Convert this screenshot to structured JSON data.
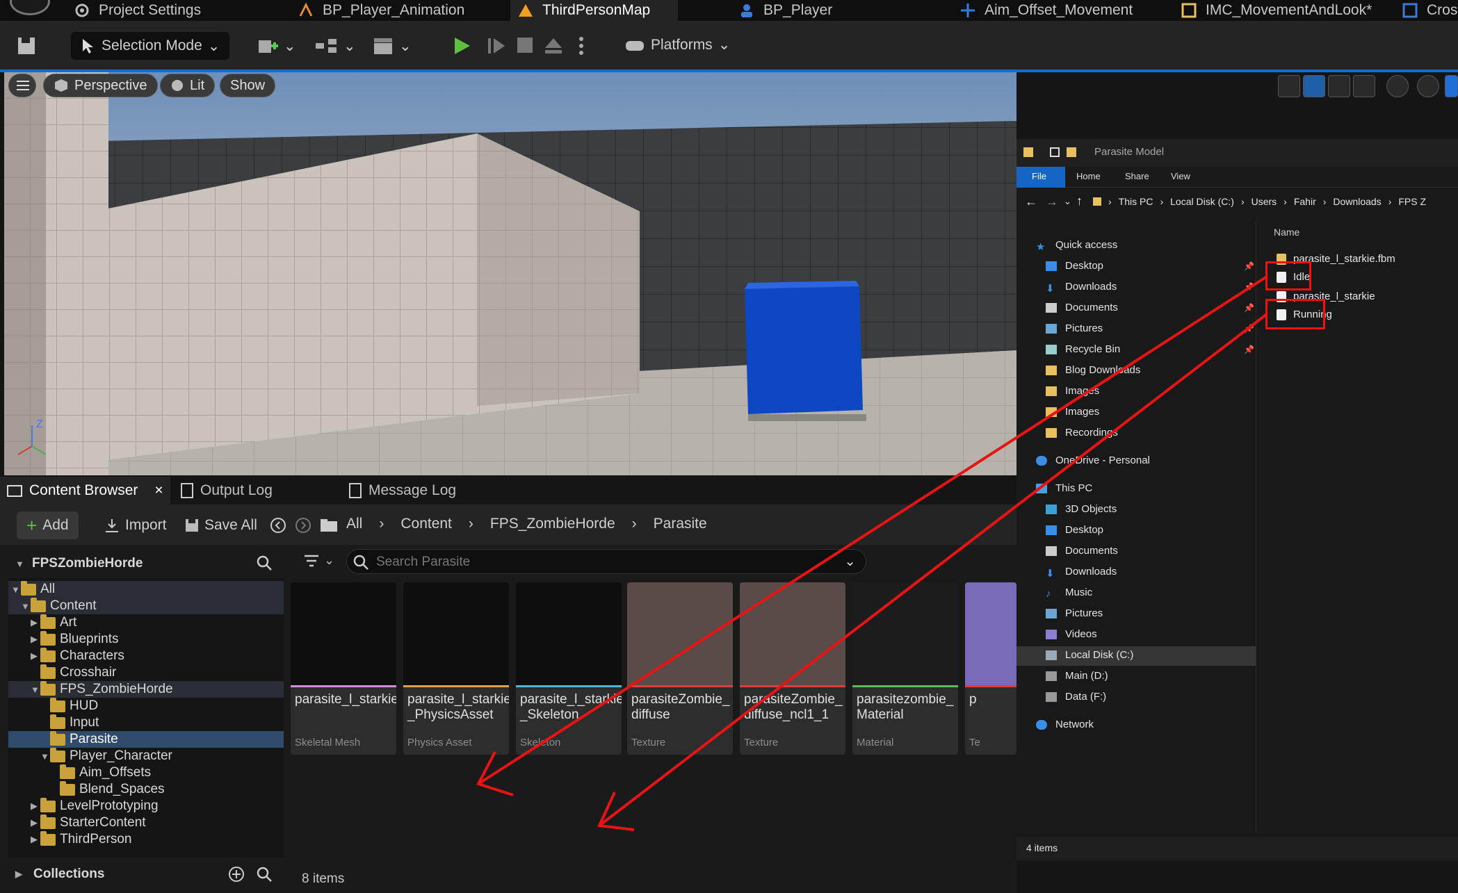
{
  "tabs": [
    {
      "label": "Project Settings",
      "icon": "gear-icon"
    },
    {
      "label": "BP_Player_Animation",
      "icon": "animation-icon"
    },
    {
      "label": "ThirdPersonMap",
      "icon": "level-icon"
    },
    {
      "label": "BP_Player",
      "icon": "blueprint-icon"
    },
    {
      "label": "Aim_Offset_Movement",
      "icon": "aim-offset-icon"
    },
    {
      "label": "IMC_MovementAndLook*",
      "icon": "input-mapping-icon"
    },
    {
      "label": "Cros",
      "icon": "blueprint-icon"
    }
  ],
  "toolbar": {
    "selection_mode": "Selection Mode",
    "platforms": "Platforms"
  },
  "viewport": {
    "perspective": "Perspective",
    "lit": "Lit",
    "show": "Show",
    "axis_z": "Z"
  },
  "explorer": {
    "title": "Parasite Model",
    "ribbon": [
      "File",
      "Home",
      "Share",
      "View"
    ],
    "breadcrumb": [
      "This PC",
      "Local Disk (C:)",
      "Users",
      "Fahir",
      "Downloads",
      "FPS Z"
    ],
    "column_name": "Name",
    "quick_access": "Quick access",
    "quick_items": [
      "Desktop",
      "Downloads",
      "Documents",
      "Pictures",
      "Recycle Bin",
      "Blog Downloads",
      "Images",
      "Images",
      "Recordings"
    ],
    "onedrive": "OneDrive - Personal",
    "this_pc": "This PC",
    "pc_items": [
      "3D Objects",
      "Desktop",
      "Documents",
      "Downloads",
      "Music",
      "Pictures",
      "Videos",
      "Local Disk (C:)",
      "Main (D:)",
      "Data (F:)"
    ],
    "network": "Network",
    "files": [
      "parasite_l_starkie.fbm",
      "Idle",
      "parasite_l_starkie",
      "Running"
    ],
    "status": "4 items"
  },
  "content_browser": {
    "tabs": [
      "Content Browser",
      "Output Log",
      "Message Log"
    ],
    "add": "Add",
    "import": "Import",
    "save_all": "Save All",
    "path": [
      "All",
      "Content",
      "FPS_ZombieHorde",
      "Parasite"
    ],
    "tree_root": "FPSZombieHorde",
    "tree": [
      {
        "label": "All",
        "depth": 0,
        "caret": "▼"
      },
      {
        "label": "Content",
        "depth": 1,
        "caret": "▼"
      },
      {
        "label": "Art",
        "depth": 2,
        "caret": "▶"
      },
      {
        "label": "Blueprints",
        "depth": 2,
        "caret": "▶"
      },
      {
        "label": "Characters",
        "depth": 2,
        "caret": "▶"
      },
      {
        "label": "Crosshair",
        "depth": 2,
        "caret": ""
      },
      {
        "label": "FPS_ZombieHorde",
        "depth": 2,
        "caret": "▼"
      },
      {
        "label": "HUD",
        "depth": 3,
        "caret": ""
      },
      {
        "label": "Input",
        "depth": 3,
        "caret": ""
      },
      {
        "label": "Parasite",
        "depth": 3,
        "caret": ""
      },
      {
        "label": "Player_Character",
        "depth": 3,
        "caret": "▼"
      },
      {
        "label": "Aim_Offsets",
        "depth": 4,
        "caret": ""
      },
      {
        "label": "Blend_Spaces",
        "depth": 4,
        "caret": ""
      },
      {
        "label": "LevelPrototyping",
        "depth": 2,
        "caret": "▶"
      },
      {
        "label": "StarterContent",
        "depth": 2,
        "caret": "▶"
      },
      {
        "label": "ThirdPerson",
        "depth": 2,
        "caret": "▶"
      }
    ],
    "collections": "Collections",
    "search_placeholder": "Search Parasite",
    "assets": [
      {
        "name": "parasite_l_starkie",
        "type": "Skeletal Mesh",
        "color": "#d68be0"
      },
      {
        "name": "parasite_l_starkie\n_PhysicsAsset",
        "type": "Physics Asset",
        "color": "#e0a050"
      },
      {
        "name": "parasite_l_starkie\n_Skeleton",
        "type": "Skeleton",
        "color": "#4fb6d8"
      },
      {
        "name": "parasiteZombie_\ndiffuse",
        "type": "Texture",
        "color": "#d84040"
      },
      {
        "name": "parasiteZombie_\ndiffuse_ncl1_1",
        "type": "Texture",
        "color": "#d84040"
      },
      {
        "name": "parasitezombie_\nMaterial",
        "type": "Material",
        "color": "#5cb85c"
      },
      {
        "name": "p",
        "type": "Te",
        "color": "#d84040"
      }
    ],
    "item_count": "8 items"
  }
}
